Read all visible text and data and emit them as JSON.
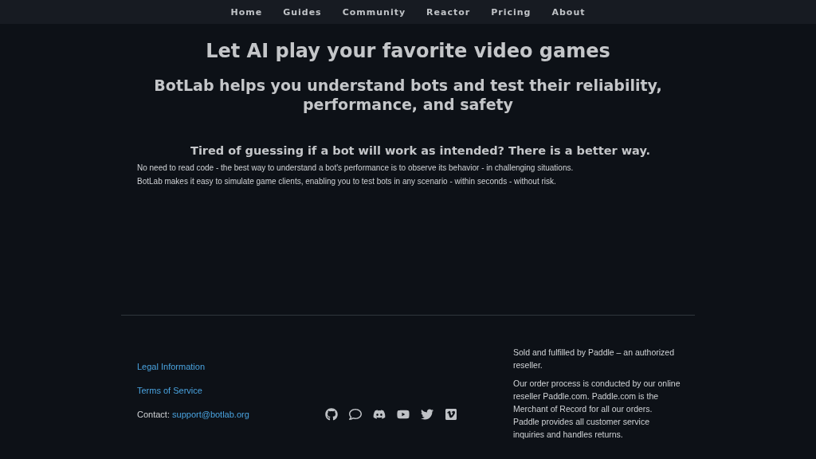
{
  "nav": {
    "items": [
      "Home",
      "Guides",
      "Community",
      "Reactor",
      "Pricing",
      "About"
    ]
  },
  "hero": {
    "title": "Let AI play your favorite video games",
    "subtitle": "BotLab helps you understand bots and test their reliability, performance, and safety"
  },
  "section": {
    "heading": "Tired of guessing if a bot will work as intended? There is a better way.",
    "paragraphs": [
      "No need to read code - the best way to understand a bot's performance is to observe its behavior - in challenging situations.",
      "BotLab makes it easy to simulate game clients, enabling you to test bots in any scenario - within seconds - without risk."
    ]
  },
  "footer": {
    "links": [
      "Legal Information",
      "Terms of Service"
    ],
    "contact": {
      "label": "Contact: ",
      "email": "support@botlab.org"
    },
    "social": [
      {
        "kind": "github"
      },
      {
        "kind": "chat"
      },
      {
        "kind": "discord"
      },
      {
        "kind": "youtube"
      },
      {
        "kind": "twitter"
      },
      {
        "kind": "vimeo"
      }
    ],
    "notes": [
      "Sold and fulfilled by Paddle – an authorized reseller.",
      "Our order process is conducted by our online reseller Paddle.com. Paddle.com is the Merchant of Record for all our orders. Paddle provides all customer service inquiries and handles returns."
    ]
  }
}
